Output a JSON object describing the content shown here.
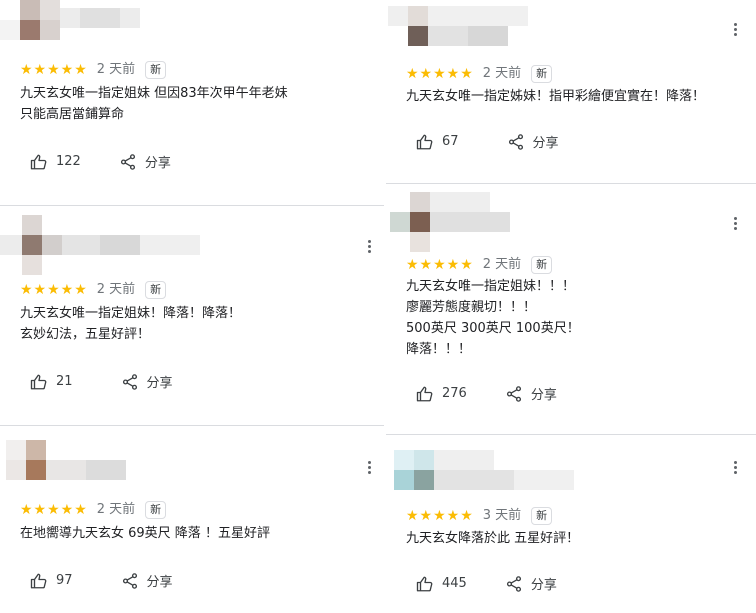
{
  "reviews_left": [
    {
      "stars": "★★★★★",
      "time": "2 天前",
      "badge": "新",
      "lines": [
        "九天玄女唯一指定姐妹 但因83年次甲午年老妹",
        "只能高居當鋪算命"
      ],
      "likes": "122",
      "share_label": "分享"
    },
    {
      "stars": "★★★★★",
      "time": "2 天前",
      "badge": "新",
      "lines": [
        "九天玄女唯一指定姐妹！降落！降落！",
        "玄妙幻法，五星好評！"
      ],
      "likes": "21",
      "share_label": "分享"
    },
    {
      "stars": "★★★★★",
      "time": "2 天前",
      "badge": "新",
      "lines": [
        "在地嚮導九天玄女 69英尺 降落 ！五星好評"
      ],
      "likes": "97",
      "share_label": "分享"
    }
  ],
  "reviews_right": [
    {
      "stars": "★★★★★",
      "time": "2 天前",
      "badge": "新",
      "lines": [
        "九天玄女唯一指定姊妹！指甲彩繪便宜實在！降落！"
      ],
      "likes": "67",
      "share_label": "分享"
    },
    {
      "stars": "★★★★★",
      "time": "2 天前",
      "badge": "新",
      "lines": [
        "九天玄女唯一指定姐妹！！！",
        "廖麗芳態度親切！！！",
        "500英尺 300英尺 100英尺！",
        "降落！！！"
      ],
      "likes": "276",
      "share_label": "分享"
    },
    {
      "stars": "★★★★★",
      "time": "3 天前",
      "badge": "新",
      "lines": [
        "九天玄女降落於此 五星好評！"
      ],
      "likes": "445",
      "share_label": "分享"
    }
  ],
  "colors": {
    "star": "#fbbc04",
    "divider": "#dadce0",
    "muted_text": "#70757a"
  },
  "icons": {
    "like": "thumb-up-icon",
    "share": "share-icon",
    "menu": "more-vert-icon"
  }
}
